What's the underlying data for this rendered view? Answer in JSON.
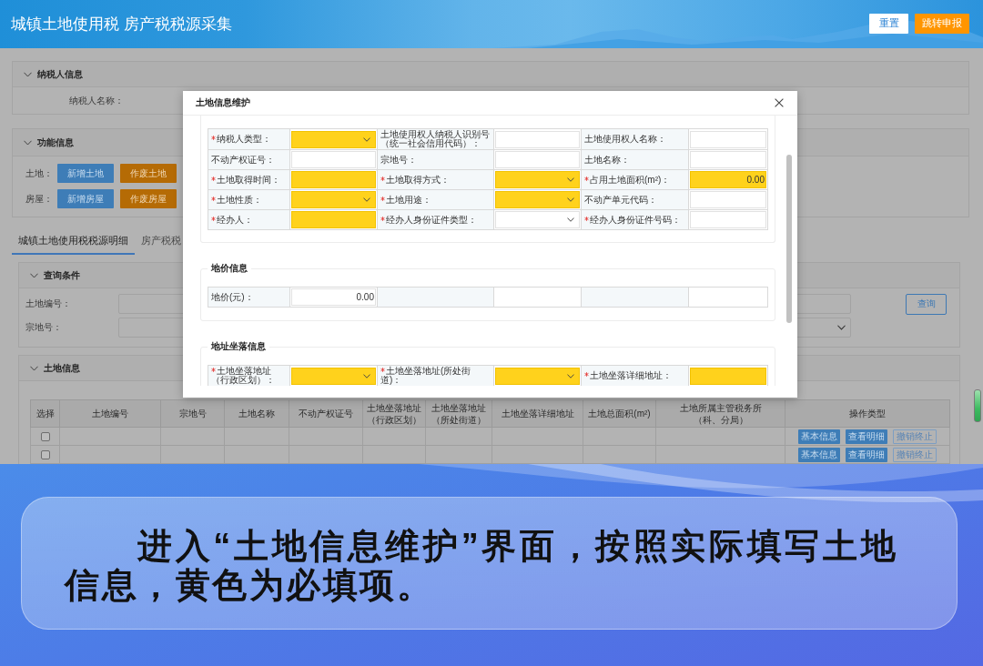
{
  "header": {
    "title": "城镇土地使用税 房产税税源采集",
    "buttons": [
      {
        "label": "重置",
        "kind": "secondary"
      },
      {
        "label": "跳转申报",
        "kind": "primary"
      }
    ]
  },
  "taxpayer_panel": {
    "title": "纳税人信息",
    "expanded": true,
    "fields": [
      {
        "label": "纳税人名称："
      }
    ]
  },
  "function_panel": {
    "title": "功能信息",
    "expanded": true,
    "rows": [
      {
        "label": "土地：",
        "buttons": [
          {
            "label": "新增土地",
            "kind": "primary"
          },
          {
            "label": "作废土地",
            "kind": "danger"
          }
        ]
      },
      {
        "label": "房屋：",
        "buttons": [
          {
            "label": "新增房屋",
            "kind": "primary"
          },
          {
            "label": "作废房屋",
            "kind": "danger"
          }
        ]
      }
    ]
  },
  "tabs": [
    {
      "label": "城镇土地使用税税源明细",
      "selected": true
    },
    {
      "label": "房产税税",
      "selected": false
    }
  ],
  "query_panel": {
    "title": "查询条件",
    "expanded": true,
    "fields": [
      {
        "label": "土地编号：",
        "kind": "input"
      },
      {
        "label": "宗地号：",
        "kind": "select"
      }
    ],
    "button": "查询"
  },
  "land_panel": {
    "title": "土地信息",
    "expanded": true,
    "table": {
      "columns": [
        "选择",
        "土地编号",
        "宗地号",
        "土地名称",
        "不动产权证号",
        "土地坐落地址（行政区划）",
        "土地坐落地址（所处街道）",
        "土地坐落详细地址",
        "土地总面积(m²)",
        "土地所属主管税务所（科、分局）",
        "操作类型"
      ],
      "rows": [
        {
          "checked": false,
          "actions": [
            {
              "label": "基本信息",
              "kind": "primary"
            },
            {
              "label": "查看明细",
              "kind": "primary"
            },
            {
              "label": "撤销终止",
              "kind": "outline"
            }
          ]
        },
        {
          "checked": false,
          "actions": [
            {
              "label": "基本信息",
              "kind": "primary"
            },
            {
              "label": "查看明细",
              "kind": "primary"
            },
            {
              "label": "撤销终止",
              "kind": "outline"
            }
          ]
        }
      ]
    }
  },
  "dialog": {
    "title": "土地信息维护",
    "sections": [
      {
        "fields": [
          {
            "label": "纳税人类型：",
            "required": true,
            "kind": "select",
            "highlighted": true
          },
          {
            "label": "土地使用权人纳税人识别号（统一社会信用代码）：",
            "required": false,
            "kind": "input",
            "highlighted": false
          },
          {
            "label": "土地使用权人名称：",
            "required": false,
            "kind": "input",
            "highlighted": false
          },
          {
            "label": "不动产权证号：",
            "required": false,
            "kind": "input",
            "highlighted": false
          },
          {
            "label": "宗地号：",
            "required": false,
            "kind": "input",
            "highlighted": false
          },
          {
            "label": "土地名称：",
            "required": false,
            "kind": "input",
            "highlighted": false
          },
          {
            "label": "土地取得时间：",
            "required": true,
            "kind": "input",
            "highlighted": true
          },
          {
            "label": "土地取得方式：",
            "required": true,
            "kind": "select",
            "highlighted": true
          },
          {
            "label": "占用土地面积(m²)：",
            "required": true,
            "kind": "input",
            "highlighted": true,
            "value": "0.00"
          },
          {
            "label": "土地性质：",
            "required": true,
            "kind": "select",
            "highlighted": true
          },
          {
            "label": "土地用途：",
            "required": true,
            "kind": "select",
            "highlighted": true
          },
          {
            "label": "不动产单元代码：",
            "required": false,
            "kind": "input",
            "highlighted": false
          },
          {
            "label": "经办人：",
            "required": true,
            "kind": "input",
            "highlighted": true
          },
          {
            "label": "经办人身份证件类型：",
            "required": true,
            "kind": "select",
            "highlighted": false
          },
          {
            "label": "经办人身份证件号码：",
            "required": true,
            "kind": "input",
            "highlighted": false
          }
        ]
      },
      {
        "title": "地价信息",
        "fields": [
          {
            "label": "地价(元)：",
            "required": false,
            "kind": "input",
            "highlighted": false,
            "value": "0.00"
          },
          {
            "kind": "blank"
          },
          {
            "kind": "blank"
          }
        ]
      },
      {
        "title": "地址坐落信息",
        "fields": [
          {
            "label": "土地坐落地址（行政区划）：",
            "required": true,
            "kind": "select",
            "highlighted": true
          },
          {
            "label": "土地坐落地址(所处街道)：",
            "required": true,
            "kind": "select",
            "highlighted": true
          },
          {
            "label": "土地坐落详细地址：",
            "required": true,
            "kind": "input",
            "highlighted": true
          }
        ]
      }
    ]
  },
  "caption": {
    "text": "进入“土地信息维护”界面，按照实际填写土地信息，黄色为必填项。"
  }
}
